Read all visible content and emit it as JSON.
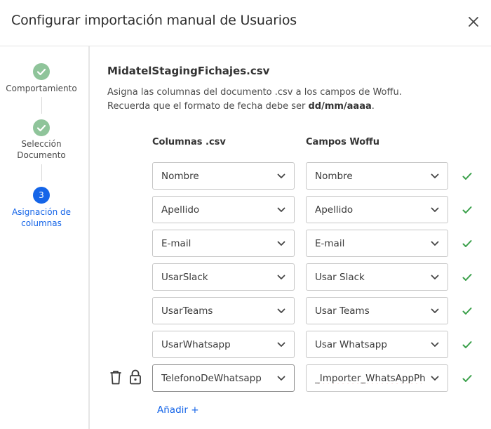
{
  "modal": {
    "title": "Configurar importación manual de Usuarios",
    "close_icon": "close-icon"
  },
  "steps": [
    {
      "label": "Comportamiento",
      "status": "done"
    },
    {
      "label": "Selección\nDocumento",
      "status": "done"
    },
    {
      "number": "3",
      "label": "Asignación de\ncolumnas",
      "status": "active"
    }
  ],
  "main": {
    "filename": "MidatelStagingFichajes.csv",
    "desc_line1": "Asigna las columnas del documento .csv a los campos de Woffu.",
    "desc_line2_prefix": "Recuerda que el formato de fecha debe ser ",
    "desc_line2_format": "dd/mm/aaaa",
    "desc_line2_suffix": ".",
    "col_csv_header": "Columnas .csv",
    "col_woffu_header": "Campos Woffu",
    "rows": [
      {
        "csv": "Nombre",
        "woffu": "Nombre"
      },
      {
        "csv": "Apellido",
        "woffu": "Apellido"
      },
      {
        "csv": "E-mail",
        "woffu": "E-mail"
      },
      {
        "csv": "UsarSlack",
        "woffu": "Usar Slack"
      },
      {
        "csv": "UsarTeams",
        "woffu": "Usar Teams"
      },
      {
        "csv": "UsarWhatsapp",
        "woffu": "Usar Whatsapp"
      },
      {
        "csv": "TelefonoDeWhatsapp",
        "woffu": "_Importer_WhatsAppPh"
      }
    ],
    "add_label": "Añadir +"
  },
  "colors": {
    "accent": "#1565e8",
    "done_step": "#8fc49a",
    "check": "#3aa04a"
  }
}
